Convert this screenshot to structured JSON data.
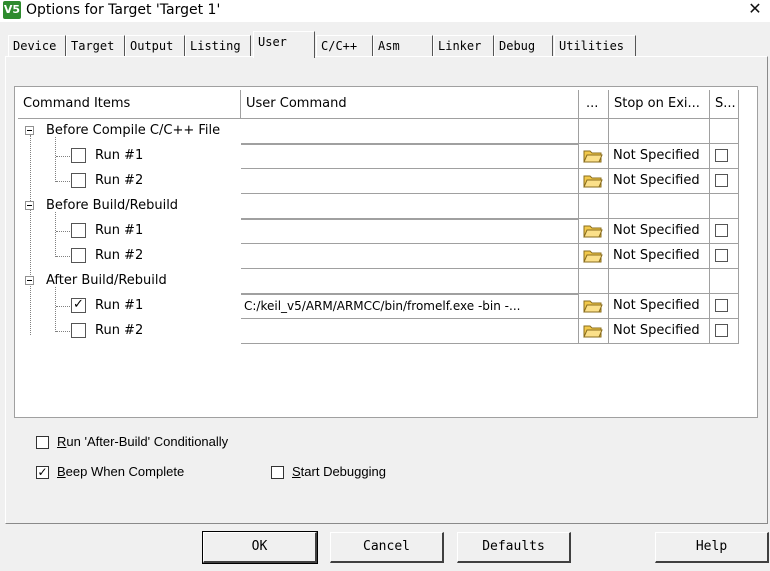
{
  "window": {
    "title": "Options for Target 'Target 1'",
    "icon_text": "V5",
    "close_glyph": "✕"
  },
  "tabs": [
    {
      "label": "Device"
    },
    {
      "label": "Target"
    },
    {
      "label": "Output"
    },
    {
      "label": "Listing"
    },
    {
      "label": "User",
      "active": true
    },
    {
      "label": "C/C++"
    },
    {
      "label": "Asm"
    },
    {
      "label": "Linker"
    },
    {
      "label": "Debug"
    },
    {
      "label": "Utilities"
    }
  ],
  "grid": {
    "headers": {
      "command_items": "Command Items",
      "user_command": "User Command",
      "browse": "...",
      "stop_on_exit": "Stop on Exi...",
      "s": "S..."
    },
    "groups": [
      {
        "label": "Before Compile C/C++ File",
        "rows": [
          {
            "label": "Run #1",
            "checked": false,
            "command": "",
            "stop": "Not Specified",
            "s_checked": false
          },
          {
            "label": "Run #2",
            "checked": false,
            "command": "",
            "stop": "Not Specified",
            "s_checked": false
          }
        ]
      },
      {
        "label": "Before Build/Rebuild",
        "rows": [
          {
            "label": "Run #1",
            "checked": false,
            "command": "",
            "stop": "Not Specified",
            "s_checked": false
          },
          {
            "label": "Run #2",
            "checked": false,
            "command": "",
            "stop": "Not Specified",
            "s_checked": false
          }
        ]
      },
      {
        "label": "After Build/Rebuild",
        "rows": [
          {
            "label": "Run #1",
            "checked": true,
            "command": "C:/keil_v5/ARM/ARMCC/bin/fromelf.exe  -bin -...",
            "stop": "Not Specified",
            "s_checked": false
          },
          {
            "label": "Run #2",
            "checked": false,
            "command": "",
            "stop": "Not Specified",
            "s_checked": false
          }
        ]
      }
    ]
  },
  "options": {
    "run_after_build": {
      "mnemonic": "R",
      "rest": "un 'After-Build' Conditionally",
      "checked": false
    },
    "beep": {
      "mnemonic": "B",
      "rest": "eep When Complete",
      "checked": true
    },
    "start_debugging": {
      "mnemonic": "S",
      "rest": "tart Debugging",
      "checked": false
    }
  },
  "buttons": {
    "ok": "OK",
    "cancel": "Cancel",
    "defaults": "Defaults",
    "help": "Help"
  },
  "colors": {
    "folder_yellow": "#f2c94c",
    "check_mark": "#000000"
  }
}
